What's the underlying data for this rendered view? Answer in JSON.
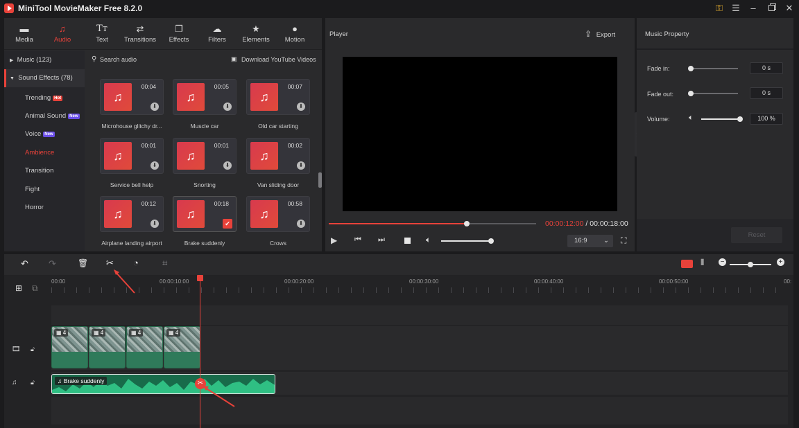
{
  "app": {
    "title": "MiniTool MovieMaker Free 8.2.0"
  },
  "colors": {
    "accent": "#e8423a",
    "panel": "#2a2a2c",
    "bg": "#1b1b1d",
    "audio_clip": "#2aa876"
  },
  "tabs": [
    {
      "label": "Media",
      "icon": "folder-icon"
    },
    {
      "label": "Audio",
      "icon": "music-note-icon",
      "active": true
    },
    {
      "label": "Text",
      "icon": "text-icon"
    },
    {
      "label": "Transitions",
      "icon": "transitions-icon"
    },
    {
      "label": "Effects",
      "icon": "effects-icon"
    },
    {
      "label": "Filters",
      "icon": "filters-icon"
    },
    {
      "label": "Elements",
      "icon": "elements-icon"
    },
    {
      "label": "Motion",
      "icon": "motion-icon"
    }
  ],
  "categories": {
    "music": "Music (123)",
    "sound_effects": "Sound Effects (78)",
    "sub": [
      "Trending",
      "Animal Sound",
      "Voice",
      "Ambience",
      "Transition",
      "Fight",
      "Horror"
    ],
    "badge_hot": "Hot",
    "badge_new": "New"
  },
  "library": {
    "search_placeholder": "Search audio",
    "download_label": "Download YouTube Videos",
    "items": [
      {
        "name": "Microhouse glitchy dr...",
        "duration": "00:04"
      },
      {
        "name": "Muscle car",
        "duration": "00:05"
      },
      {
        "name": "Old car starting",
        "duration": "00:07"
      },
      {
        "name": "Service bell help",
        "duration": "00:01"
      },
      {
        "name": "Snorting",
        "duration": "00:01"
      },
      {
        "name": "Van sliding door",
        "duration": "00:02"
      },
      {
        "name": "Airplane landing airport",
        "duration": "00:12"
      },
      {
        "name": "Brake suddenly",
        "duration": "00:18",
        "added": true
      },
      {
        "name": "Crows",
        "duration": "00:58"
      }
    ]
  },
  "player": {
    "title": "Player",
    "export_label": "Export",
    "current_time": "00:00:12:00",
    "separator": " / ",
    "total_time": "00:00:18:00",
    "progress": 0.667,
    "volume": 1.0,
    "aspect": "16:9"
  },
  "property": {
    "title": "Music Property",
    "fade_in_label": "Fade in:",
    "fade_in_value": "0 s",
    "fade_in": 0.0,
    "fade_out_label": "Fade out:",
    "fade_out_value": "0 s",
    "fade_out": 0.0,
    "volume_label": "Volume:",
    "volume_value": "100 %",
    "volume": 1.0,
    "reset_label": "Reset"
  },
  "timeline": {
    "ticks": [
      "00:00",
      "00:00:10:00",
      "00:00:20:00",
      "00:00:30:00",
      "00:00:40:00",
      "00:00:50:00",
      "00:"
    ],
    "video_clip_label": "4",
    "video_clip_count": 4,
    "audio_clip_label": "Brake suddenly",
    "zoom": 0.5
  }
}
